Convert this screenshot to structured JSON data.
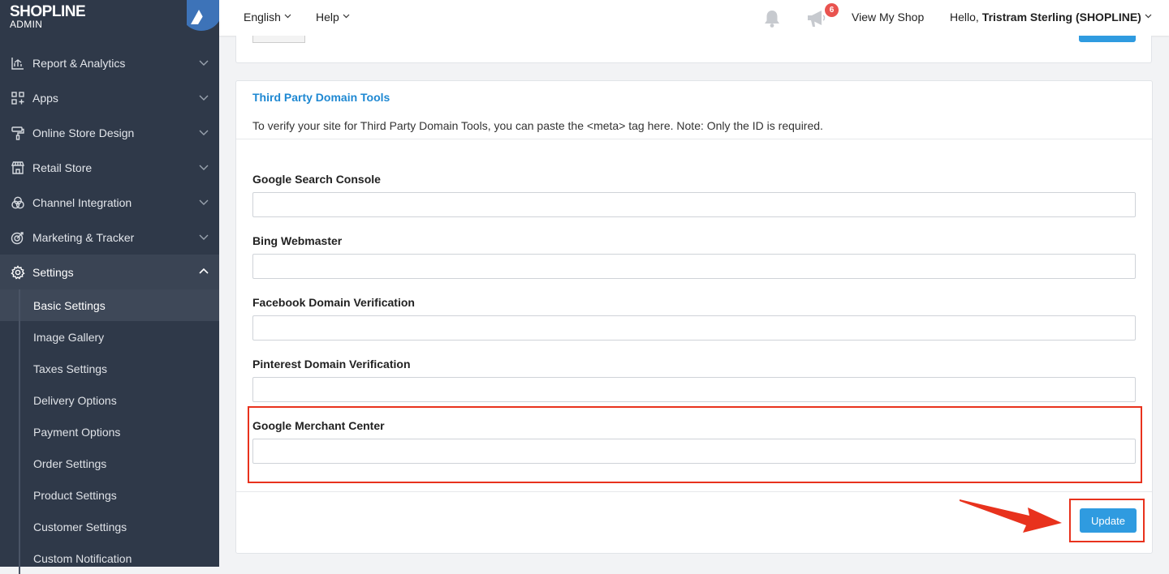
{
  "brand": {
    "logo": "SHOPLINE",
    "sub": "ADMIN"
  },
  "sidebar": {
    "items": [
      {
        "label": "Report & Analytics",
        "icon": "chart-icon"
      },
      {
        "label": "Apps",
        "icon": "apps-icon"
      },
      {
        "label": "Online Store Design",
        "icon": "paint-roller-icon"
      },
      {
        "label": "Retail Store",
        "icon": "store-icon"
      },
      {
        "label": "Channel Integration",
        "icon": "channel-icon"
      },
      {
        "label": "Marketing & Tracker",
        "icon": "target-icon"
      },
      {
        "label": "Settings",
        "icon": "gear-icon"
      }
    ],
    "settings_sub": [
      "Basic Settings",
      "Image Gallery",
      "Taxes Settings",
      "Delivery Options",
      "Payment Options",
      "Order Settings",
      "Product Settings",
      "Customer Settings",
      "Custom Notification"
    ]
  },
  "topbar": {
    "language": "English",
    "help": "Help",
    "notification_count": "6",
    "view_shop": "View My Shop",
    "greeting": "Hello,",
    "user": "Tristram Sterling (SHOPLINE)"
  },
  "card": {
    "title": "Third Party Domain Tools",
    "description": "To verify your site for Third Party Domain Tools, you can paste the <meta> tag here. Note: Only the ID is required.",
    "fields": [
      {
        "label": "Google Search Console",
        "value": ""
      },
      {
        "label": "Bing Webmaster",
        "value": ""
      },
      {
        "label": "Facebook Domain Verification",
        "value": ""
      },
      {
        "label": "Pinterest Domain Verification",
        "value": ""
      },
      {
        "label": "Google Merchant Center",
        "value": ""
      }
    ],
    "update_label": "Update"
  },
  "colors": {
    "sidebar_bg": "#2f3949",
    "accent": "#2f9be0",
    "title_blue": "#1e88d2",
    "highlight": "#e8321d",
    "badge": "#e9534f"
  }
}
